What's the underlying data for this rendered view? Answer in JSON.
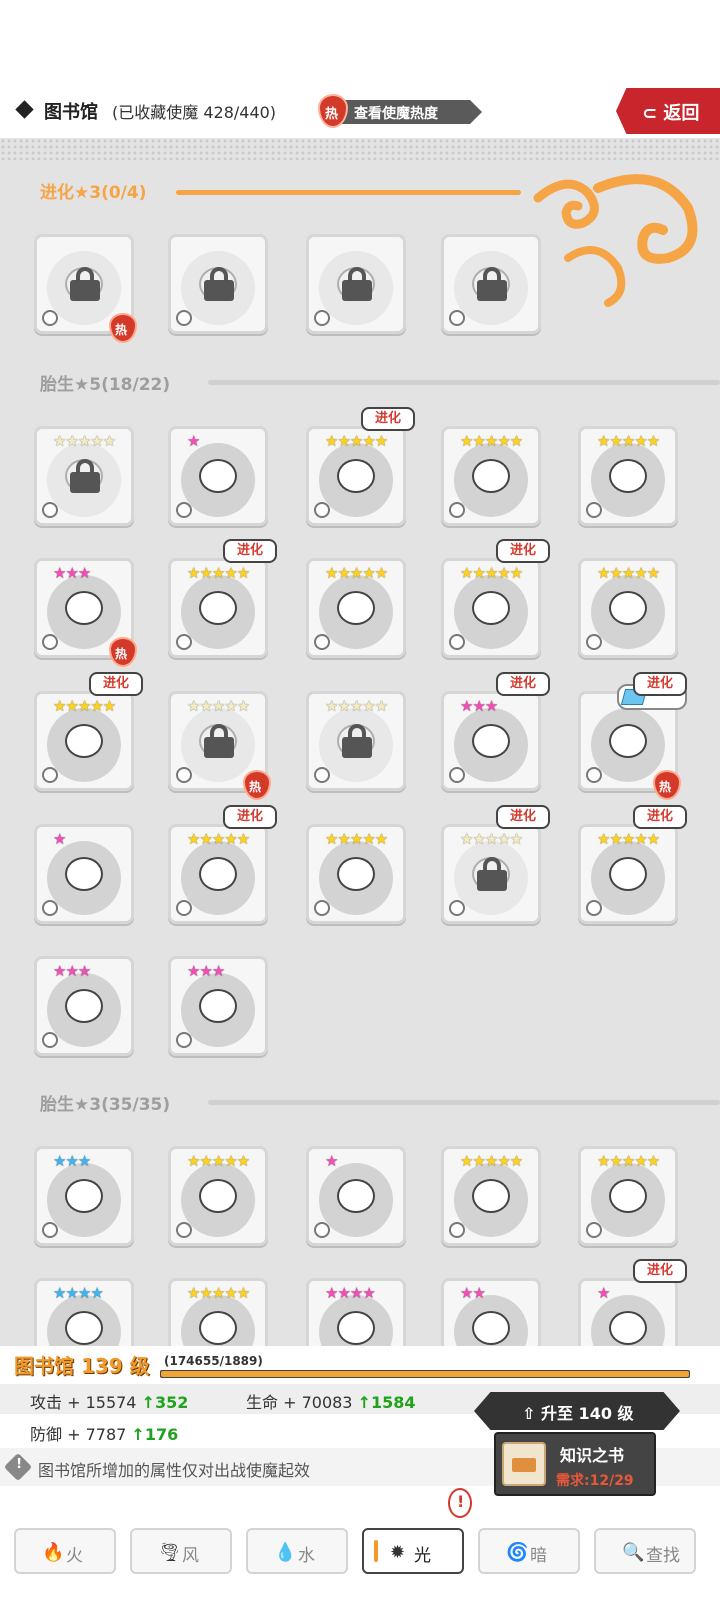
{
  "header": {
    "title": "图书馆",
    "subtitle": "(已收藏使魔 428/440)",
    "heat_icon_label": "热",
    "heat_button": "查看使魔热度",
    "back_button": "返回",
    "back_icon": "return-arrow-icon"
  },
  "sections": [
    {
      "title": "进化★3(0/4)",
      "color": "#f5a545"
    },
    {
      "title": "胎生★5(18/22)",
      "color": "#9e9e9e"
    },
    {
      "title": "胎生★3(35/35)",
      "color": "#9e9e9e"
    }
  ],
  "tags": {
    "evolve": "进化",
    "hot": "热"
  },
  "star_colors": {
    "gold": "#ffd21e",
    "pink": "#f04fb6",
    "blue": "#3fb4f0"
  },
  "library": {
    "level_label": "图书馆 139 级",
    "xp_text": "(174655/1889)",
    "xp_fill": 1.0,
    "attack_label": "攻击 + 15574",
    "attack_up": "352",
    "hp_label": "生命 + 70083",
    "hp_up": "1584",
    "defense_label": "防御 + 7787",
    "defense_up": "176",
    "up_arrow": "↑",
    "note": "图书馆所增加的属性仅对出战使魔起效",
    "note_icon": "!"
  },
  "upgrade": {
    "button": "升至 140 级",
    "book_name": "知识之书",
    "requirement": "需求:12/29"
  },
  "tabs": [
    {
      "label": "火",
      "icon": "fire-icon",
      "glyph": "🔥",
      "active": false
    },
    {
      "label": "风",
      "icon": "wind-icon",
      "glyph": "🌪",
      "active": false
    },
    {
      "label": "水",
      "icon": "water-icon",
      "glyph": "💧",
      "active": false
    },
    {
      "label": "光",
      "icon": "light-icon",
      "glyph": "✹",
      "active": true
    },
    {
      "label": "暗",
      "icon": "dark-icon",
      "glyph": "🌀",
      "active": false
    },
    {
      "label": "查找",
      "icon": "search-icon",
      "glyph": "🔍",
      "active": false
    }
  ],
  "tab_alert": "!"
}
